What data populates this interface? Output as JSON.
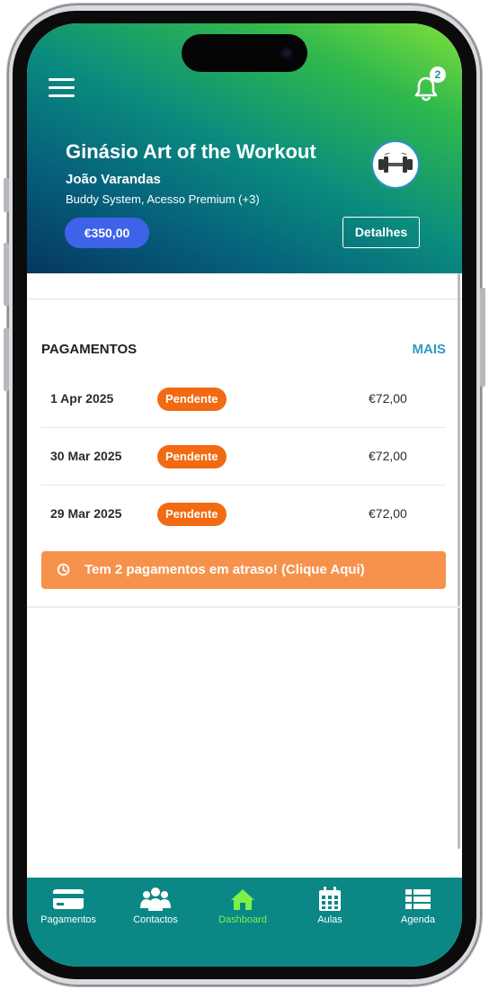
{
  "header": {
    "gym_name": "Ginásio Art of the Workout",
    "member_name": "João Varandas",
    "plan": "Buddy System, Acesso Premium (+3)",
    "balance": "€350,00",
    "details_label": "Detalhes",
    "notification_count": "2"
  },
  "payments": {
    "title": "PAGAMENTOS",
    "more_label": "MAIS",
    "items": [
      {
        "date": "1 Apr 2025",
        "status": "Pendente",
        "amount": "€72,00"
      },
      {
        "date": "30 Mar 2025",
        "status": "Pendente",
        "amount": "€72,00"
      },
      {
        "date": "29 Mar 2025",
        "status": "Pendente",
        "amount": "€72,00"
      }
    ],
    "alert": "Tem 2 pagamentos em atraso! (Clique Aqui)"
  },
  "tabbar": {
    "items": [
      {
        "label": "Pagamentos",
        "icon": "credit-card-icon"
      },
      {
        "label": "Contactos",
        "icon": "users-icon"
      },
      {
        "label": "Dashboard",
        "icon": "home-icon",
        "active": true
      },
      {
        "label": "Aulas",
        "icon": "calendar-icon"
      },
      {
        "label": "Agenda",
        "icon": "list-icon"
      }
    ]
  },
  "colors": {
    "accent": "#2d9bc2",
    "status_pending": "#f26a12",
    "alert": "#f7924c",
    "balance_pill": "#3f63e8",
    "tabbar": "#0b8886",
    "tab_active": "#7df04a"
  }
}
